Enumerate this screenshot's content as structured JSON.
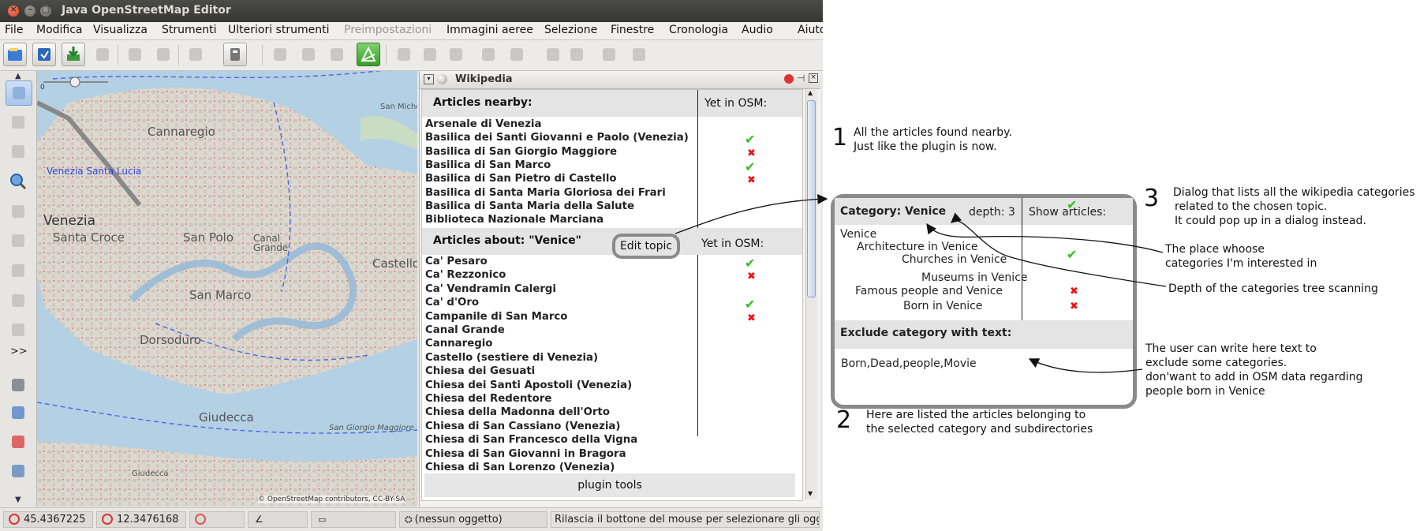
{
  "window": {
    "title": "Java OpenStreetMap Editor"
  },
  "menu": [
    "File",
    "Modifica",
    "Visualizza",
    "Strumenti",
    "Ulteriori strumenti",
    "Preimpostazioni",
    "Immagini aeree",
    "Selezione",
    "Finestre",
    "Cronologia",
    "Audio",
    "Aiuto"
  ],
  "menu_disabled": "Preimpostazioni",
  "lefttoolbar": {
    "more_label": ">>"
  },
  "map": {
    "labels": [
      "Cannaregio",
      "Venezia Santa Lucia",
      "Venezia",
      "Santa Croce",
      "San Polo",
      "Canal Grande",
      "San Marco",
      "Dorsoduro",
      "Castello",
      "San Giorgio Maggiore",
      "Giudecca",
      "Giudecca",
      "San Michele"
    ],
    "copyright": "© OpenStreetMap contributors, CC-BY-SA",
    "scale_zero": "0"
  },
  "wikipedia": {
    "panel_title": "Wikipedia",
    "nearby_header": "Articles nearby:",
    "yet_in_osm": "Yet in OSM:",
    "nearby": [
      {
        "name": "Arsenale di Venezia",
        "status": ""
      },
      {
        "name": "Basilica dei Santi Giovanni e Paolo (Venezia)",
        "status": "yes"
      },
      {
        "name": "Basilica di San Giorgio Maggiore",
        "status": "no"
      },
      {
        "name": "Basilica di San Marco",
        "status": "yes"
      },
      {
        "name": "Basilica di San Pietro di Castello",
        "status": "no"
      },
      {
        "name": "Basilica di Santa Maria Gloriosa dei Frari",
        "status": ""
      },
      {
        "name": "Basilica di Santa Maria della Salute",
        "status": ""
      },
      {
        "name": "Biblioteca Nazionale Marciana",
        "status": ""
      }
    ],
    "about_header": "Articles about: \"Venice\"",
    "edit_topic": "Edit topic",
    "about": [
      {
        "name": "Ca' Pesaro",
        "status": "yes"
      },
      {
        "name": "Ca' Rezzonico",
        "status": "no"
      },
      {
        "name": "Ca' Vendramin Calergi",
        "status": ""
      },
      {
        "name": "Ca' d'Oro",
        "status": "yes"
      },
      {
        "name": "Campanile di San Marco",
        "status": "no"
      },
      {
        "name": "Canal Grande",
        "status": ""
      },
      {
        "name": "Cannaregio",
        "status": ""
      },
      {
        "name": "Castello (sestiere di Venezia)",
        "status": ""
      },
      {
        "name": "Chiesa dei Gesuati",
        "status": ""
      },
      {
        "name": "Chiesa dei Santi Apostoli (Venezia)",
        "status": ""
      },
      {
        "name": "Chiesa del Redentore",
        "status": ""
      },
      {
        "name": "Chiesa della Madonna dell'Orto",
        "status": ""
      },
      {
        "name": "Chiesa di San Cassiano (Venezia)",
        "status": ""
      },
      {
        "name": "Chiesa di San Francesco della Vigna",
        "status": ""
      },
      {
        "name": "Chiesa di San Giovanni in Bragora",
        "status": ""
      },
      {
        "name": "Chiesa di San Lorenzo (Venezia)",
        "status": ""
      }
    ],
    "plugin_tools": "plugin tools"
  },
  "status": {
    "lat": "45.4367225",
    "lon": "12.3476168",
    "selection": "(nessun oggetto)",
    "hint": "Rilascia il bottone del mouse per selezionare gli ogg"
  },
  "mockup": {
    "category_label": "Category: Venice",
    "depth_label": "depth: 3",
    "show_articles": "Show articles:",
    "categories": [
      {
        "name": "Venice",
        "status": ""
      },
      {
        "name": "Architecture in Venice",
        "status": "yes"
      },
      {
        "name": "Churches in Venice",
        "status": "yes"
      },
      {
        "name": "Museums in Venice",
        "status": ""
      },
      {
        "name": "Famous people and Venice",
        "status": "no"
      },
      {
        "name": "Born in Venice",
        "status": "no"
      }
    ],
    "exclude_header": "Exclude category with text:",
    "exclude_value": "Born,Dead,people,Movie"
  },
  "annotations": {
    "n1": "1",
    "n1_lines": [
      "All the articles found nearby.",
      "Just like the plugin is now."
    ],
    "n2": "2",
    "n2_lines": [
      "Here are listed the articles belonging to",
      "the selected category and subdirectories"
    ],
    "n3": "3",
    "n3_lines": [
      "Dialog that lists all the wikipedia categories",
      "related to the chosen topic.",
      "It could pop up in a dialog instead."
    ],
    "place_lines": [
      "The place whoose",
      "categories I'm interested in"
    ],
    "depth_note": "Depth of the categories tree scanning",
    "user_lines": [
      "The user can write here text to",
      "exclude some categories.",
      " don'want to add in OSM data regarding",
      "people born in Venice"
    ]
  },
  "colors": {
    "check": "#2bc11a",
    "cross": "#e11111",
    "frame": "#8a8a8a",
    "water": "#a9c8e0",
    "land": "#ddd9d2"
  },
  "icons": [
    "close-icon",
    "minimize-icon",
    "maximize-icon",
    "open-file-icon",
    "save-icon",
    "download-icon",
    "upload-icon",
    "undo-icon",
    "redo-icon",
    "preferences-icon",
    "select-icon",
    "lasso-icon",
    "draw-icon",
    "zoom-icon",
    "delete-icon"
  ]
}
